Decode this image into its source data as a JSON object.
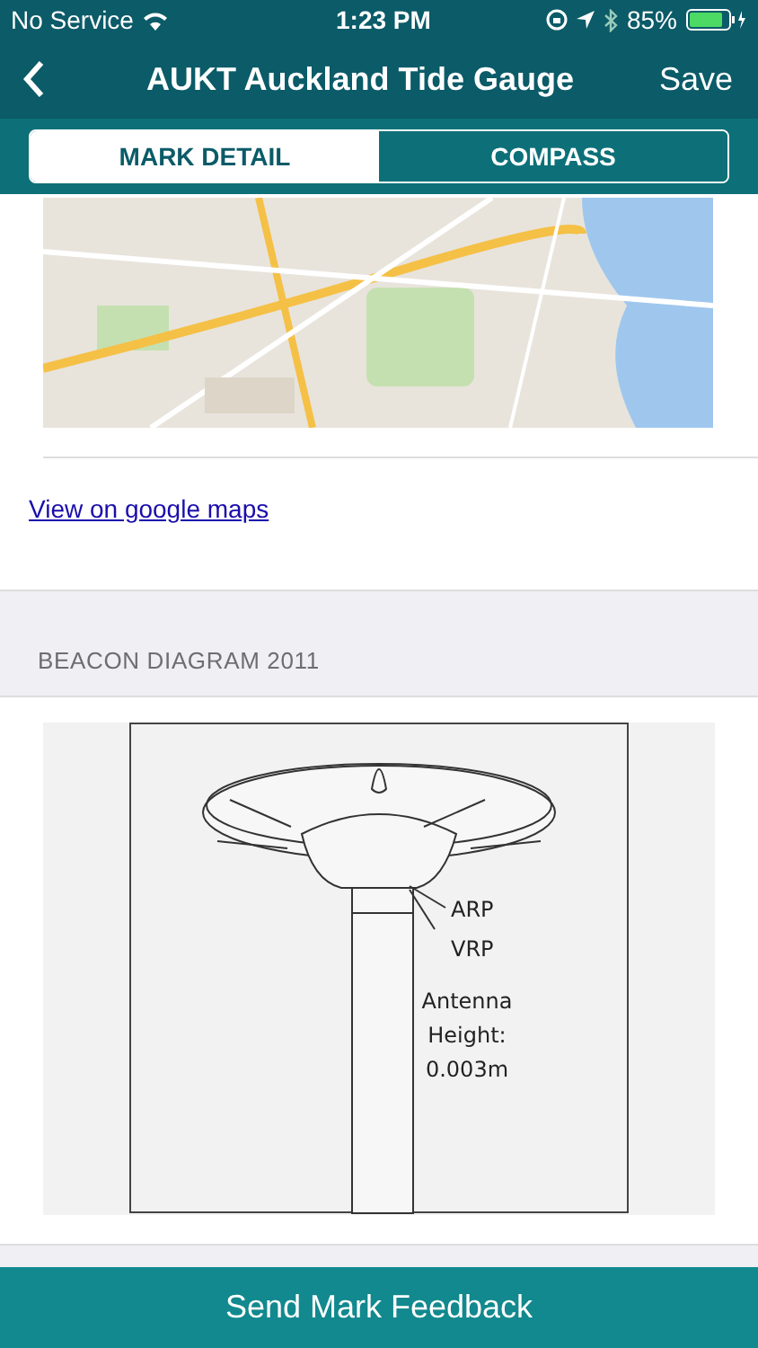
{
  "status_bar": {
    "carrier": "No Service",
    "time": "1:23 PM",
    "battery": "85%"
  },
  "nav": {
    "title": "AUKT Auckland Tide Gauge",
    "action": "Save"
  },
  "tabs": [
    {
      "label": "MARK DETAIL",
      "selected": true
    },
    {
      "label": "COMPASS",
      "selected": false
    }
  ],
  "map_link": "View on google maps",
  "diagram_section": {
    "header": "BEACON DIAGRAM 2011",
    "labels": [
      {
        "kind": "point",
        "text": "ARP"
      },
      {
        "kind": "point",
        "text": "VRP"
      },
      {
        "kind": "height",
        "text": "Antenna Height: 0.003m"
      }
    ]
  },
  "footer_button": "Send Mark Feedback"
}
